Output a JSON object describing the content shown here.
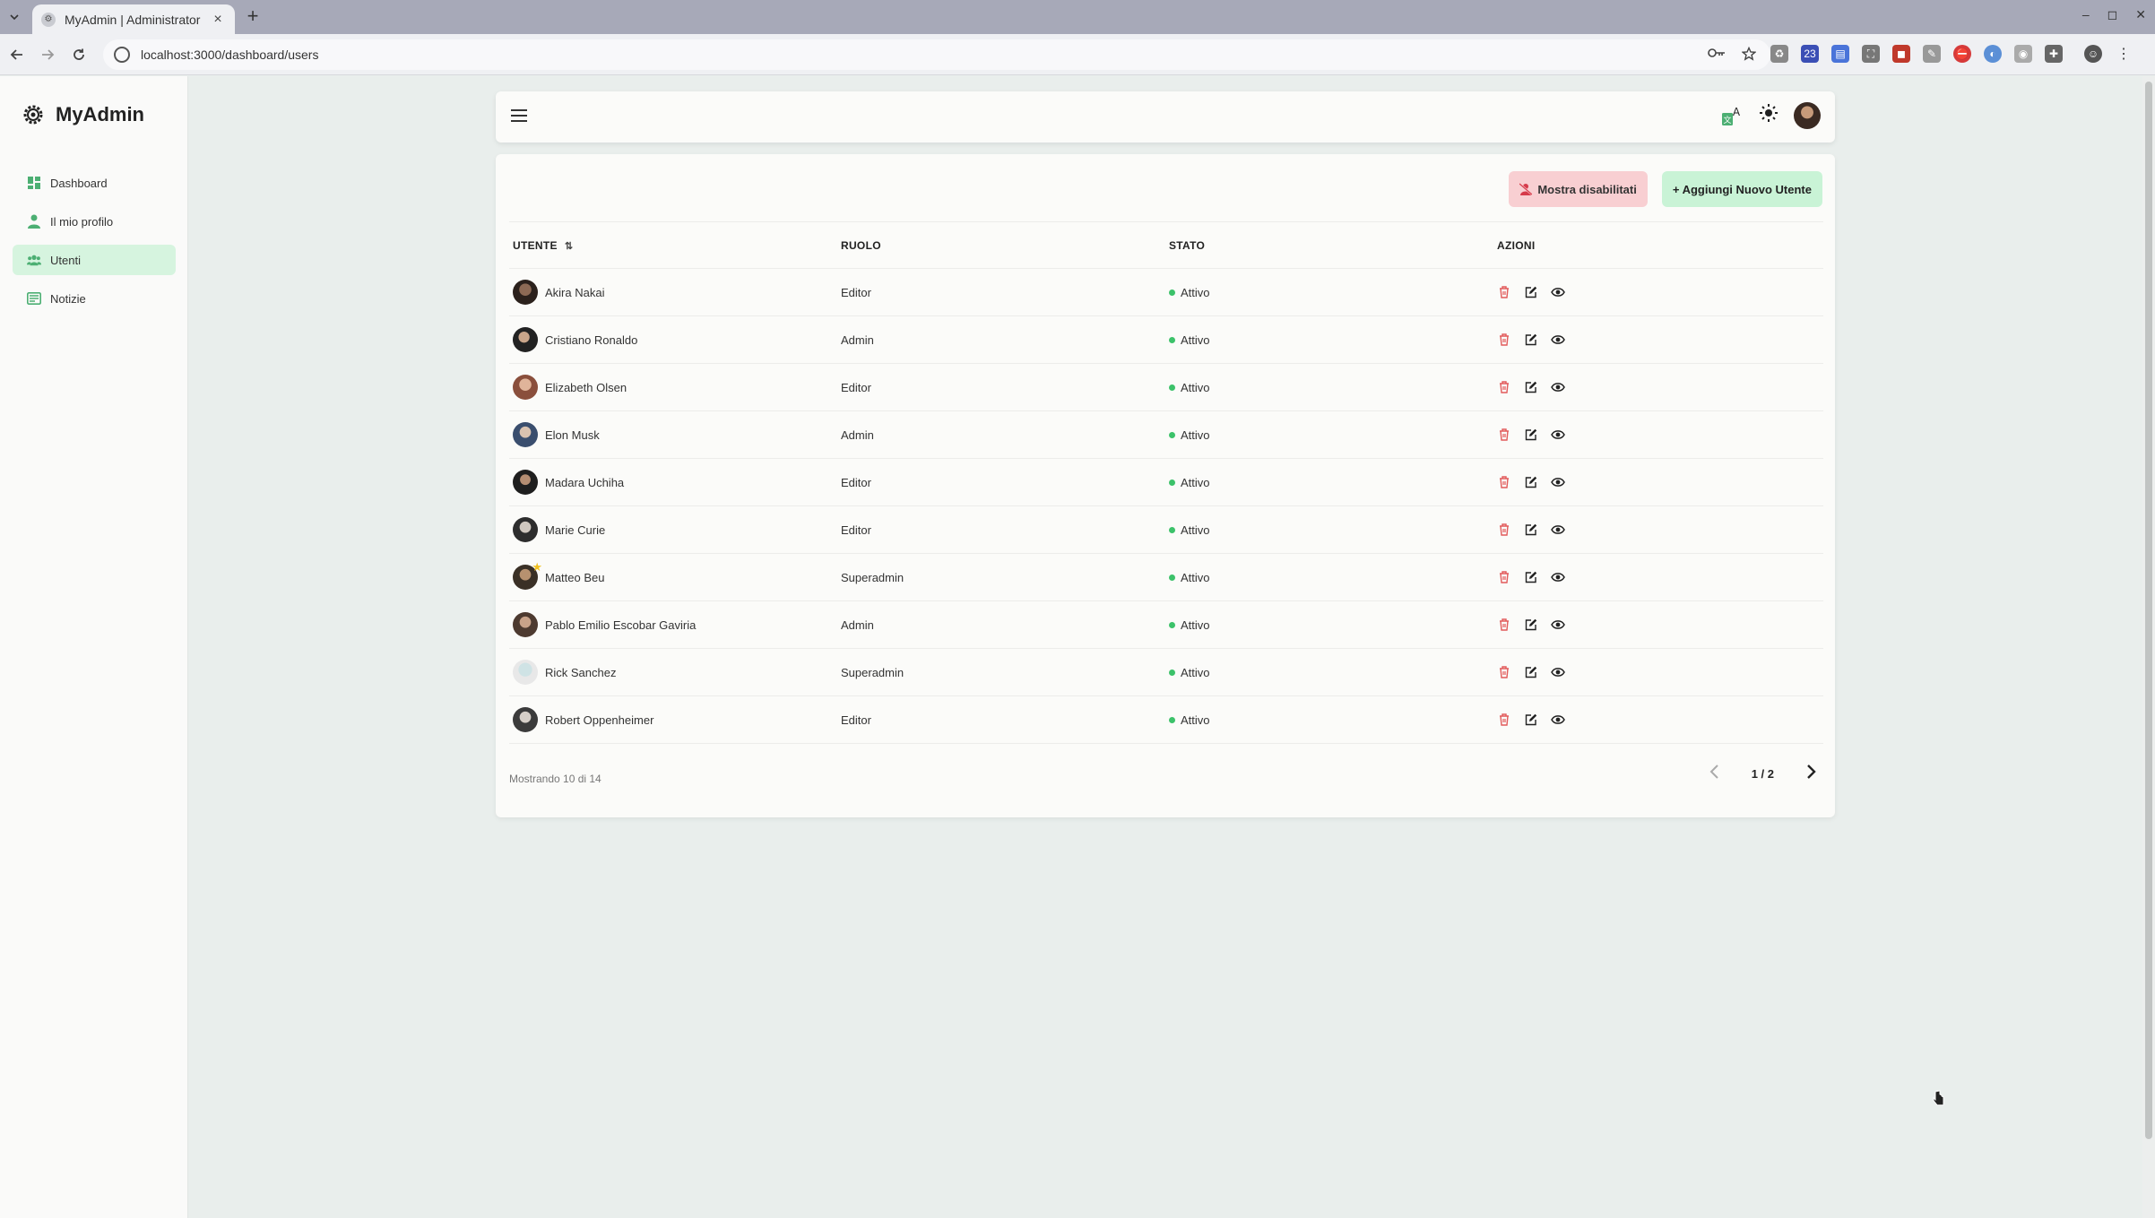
{
  "browser": {
    "tab_title": "MyAdmin | Administrator",
    "url": "localhost:3000/dashboard/users",
    "new_tab_label": "+",
    "tab_close_label": "×",
    "window_controls": [
      "–",
      "◻",
      "✕"
    ]
  },
  "sidebar": {
    "brand": "MyAdmin",
    "items": [
      {
        "label": "Dashboard",
        "icon": "dashboard-icon"
      },
      {
        "label": "Il mio profilo",
        "icon": "user-icon"
      },
      {
        "label": "Utenti",
        "icon": "users-icon",
        "active": true
      },
      {
        "label": "Notizie",
        "icon": "news-icon"
      }
    ]
  },
  "topbar": {
    "icons": [
      "menu-icon",
      "translate-icon",
      "sun-icon",
      "avatar"
    ]
  },
  "toolbar": {
    "show_disabled_label": "Mostra disabilitati",
    "add_user_label": "+ Aggiungi Nuovo Utente"
  },
  "table": {
    "headers": [
      "UTENTE",
      "RUOLO",
      "STATO",
      "AZIONI"
    ],
    "rows": [
      {
        "name": "Akira Nakai",
        "role": "Editor",
        "status": "Attivo"
      },
      {
        "name": "Cristiano Ronaldo",
        "role": "Admin",
        "status": "Attivo"
      },
      {
        "name": "Elizabeth Olsen",
        "role": "Editor",
        "status": "Attivo"
      },
      {
        "name": "Elon Musk",
        "role": "Admin",
        "status": "Attivo"
      },
      {
        "name": "Madara Uchiha",
        "role": "Editor",
        "status": "Attivo"
      },
      {
        "name": "Marie Curie",
        "role": "Editor",
        "status": "Attivo"
      },
      {
        "name": "Matteo Beu",
        "role": "Superadmin",
        "status": "Attivo",
        "starred": true
      },
      {
        "name": "Pablo Emilio Escobar Gaviria",
        "role": "Admin",
        "status": "Attivo"
      },
      {
        "name": "Rick Sanchez",
        "role": "Superadmin",
        "status": "Attivo"
      },
      {
        "name": "Robert Oppenheimer",
        "role": "Editor",
        "status": "Attivo"
      }
    ]
  },
  "footer": {
    "showing": "Mostrando 10 di 14",
    "page": "1 / 2"
  },
  "colors": {
    "active_nav": "#d6f4df",
    "danger_button": "#f8cfd2",
    "success_button": "#c9f3d6",
    "status_dot": "#3cc26a",
    "delete_icon": "#e25b5b"
  }
}
